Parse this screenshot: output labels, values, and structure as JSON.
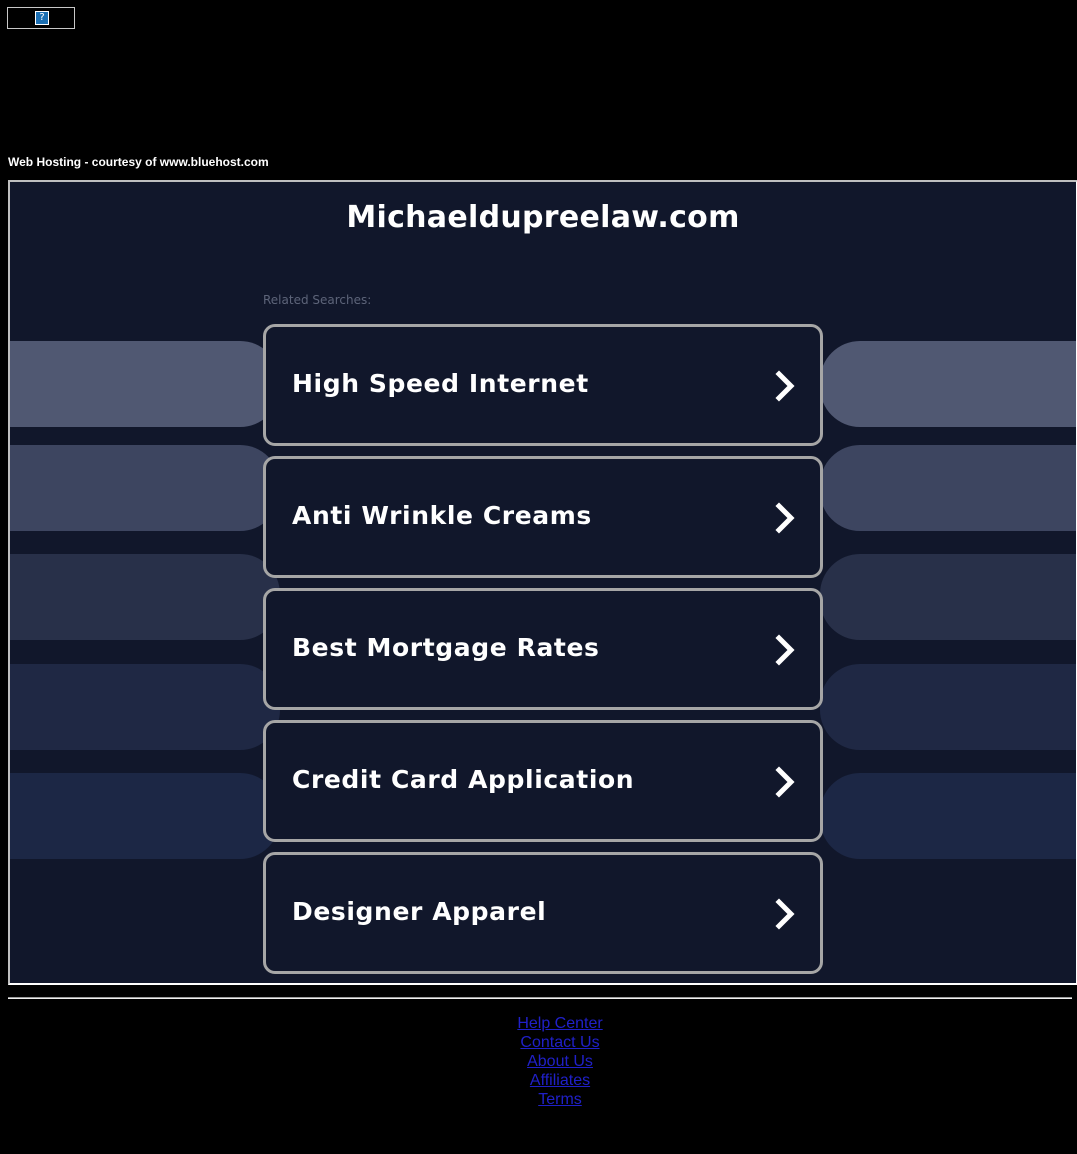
{
  "banner": {
    "icon": "broken-image-icon",
    "icon_glyph": "?"
  },
  "hosting": {
    "text": "Web Hosting - courtesy of www.bluehost.com"
  },
  "main": {
    "domain_title": "Michaeldupreelaw.com",
    "related_label": "Related Searches:",
    "searches": [
      {
        "label": "High Speed Internet"
      },
      {
        "label": "Anti Wrinkle Creams"
      },
      {
        "label": "Best Mortgage Rates"
      },
      {
        "label": "Credit Card Application"
      },
      {
        "label": "Designer Apparel"
      }
    ],
    "colors": {
      "background": "#11172b",
      "card_border": "#a6a6a6",
      "pill_colors": [
        "#505872",
        "#3d4560",
        "#283049",
        "#1f2844",
        "#1c2745"
      ]
    }
  },
  "footer": {
    "links": [
      {
        "label": "Help Center"
      },
      {
        "label": "Contact Us"
      },
      {
        "label": "About Us"
      },
      {
        "label": "Affiliates"
      },
      {
        "label": "Terms"
      }
    ]
  }
}
